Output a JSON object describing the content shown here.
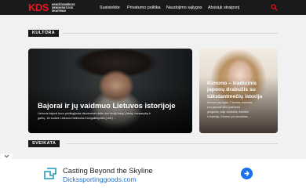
{
  "header": {
    "logo": "KDS",
    "logo_sub": [
      "KRIKŠČIONIŠKOS",
      "DEMOKRATIJOS",
      "SKAITINIAI"
    ],
    "nav": [
      "Susisiekite",
      "Privatumo politika",
      "Naudojimo sąlygos",
      "Atsisiųk straipsnį"
    ]
  },
  "sections": {
    "kultura": "KULTŪRA",
    "sveikata": "SVEIKATA"
  },
  "articles": [
    {
      "title": "Bajorai ir jų vaidmuo Lietuvos istorijoje",
      "excerpt_lines": [
        "Lietuvos bajorai buvo privilegijuota visuomenės dalis, kuri turėjo teisę į žemę, nuosavybę ir",
        "garbę. Jie sudarė Lietuvos Didžiosios Kunigaikštystės (LDK) ..."
      ]
    },
    {
      "title_lines": [
        "Kimono – tradicinis",
        "japonų drabužis su",
        "tūkstantmečių istorija"
      ],
      "excerpt_lines": [
        "Kimono yra ilgas, T formos drabužis,",
        "kurį japonai dėvi įvairiomis",
        "progomis, kaip vestuvės, šventės",
        "ir tradicijų. Kimono yra siuvamas ..."
      ]
    }
  ],
  "ad": {
    "title": "Casting Beyond the Skyline",
    "url": "Dickssportinggoods.com"
  },
  "colors": {
    "brand_red": "#e4161d",
    "header_bg": "#1a1a1a",
    "ad_link": "#1a6fc6",
    "ad_button": "#1a73e8"
  },
  "icons": {
    "search": "search-icon",
    "collapse": "chevron-down-icon",
    "ad_logo": "store-icon",
    "ad_go": "arrow-right-icon"
  }
}
